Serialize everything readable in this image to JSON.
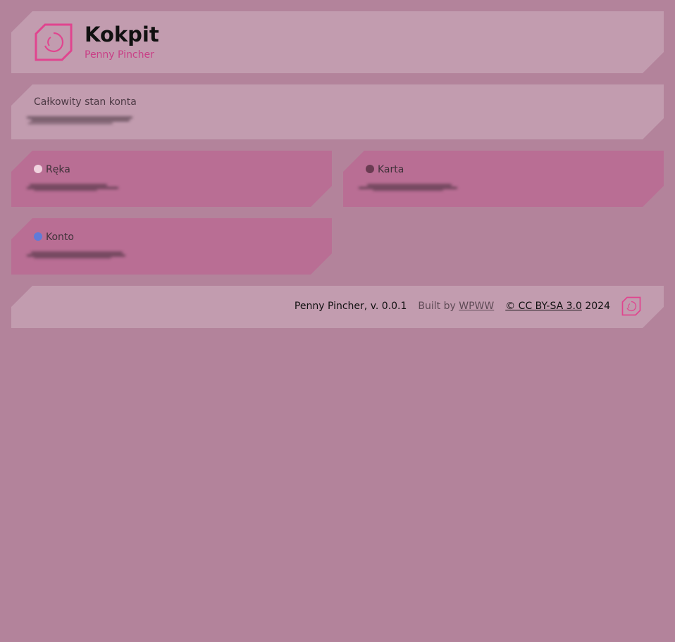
{
  "header": {
    "title": "Kokpit",
    "subtitle": "Penny Pincher",
    "logo_icon": "penny-pincher-logo-icon"
  },
  "total": {
    "label": "Całkowity stan konta",
    "value_state": "obscured"
  },
  "accounts": [
    {
      "label": "Ręka",
      "color": "#f0d3df",
      "value_state": "obscured"
    },
    {
      "label": "Karta",
      "color": "#6a3b52",
      "value_state": "obscured"
    },
    {
      "label": "Konto",
      "color": "#5f7bd8",
      "value_state": "obscured"
    }
  ],
  "footer": {
    "version_text": "Penny Pincher, v. 0.0.1",
    "built_by_prefix": "Built by",
    "built_by_link": "WPWW",
    "license_link": "© CC BY-SA 3.0",
    "year": "2024"
  },
  "colors": {
    "background": "#b3839b",
    "panel_light": "#c29caf",
    "panel_pink": "#b96e94",
    "accent": "#e0458f"
  }
}
